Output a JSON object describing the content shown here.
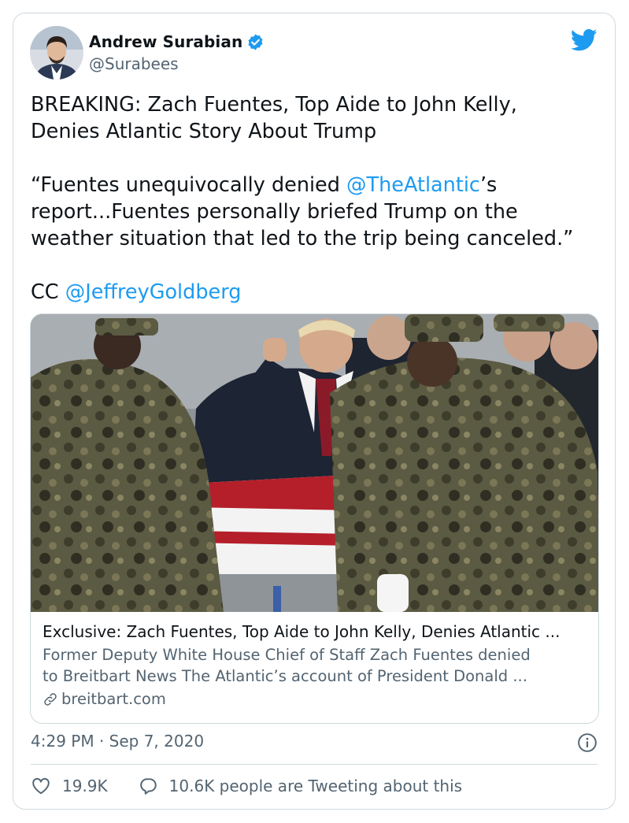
{
  "author": {
    "display_name": "Andrew Surabian",
    "handle": "@Surabees",
    "verified": true
  },
  "tweet": {
    "line1": "BREAKING: Zach Fuentes, Top Aide to John Kelly,",
    "line2": "Denies Atlantic Story About Trump",
    "quote_prefix": "“Fuentes unequivocally denied ",
    "mention_atlantic": "@TheAtlantic",
    "quote_suffix": "’s\nreport...Fuentes personally briefed Trump on the\nweather situation that led to the trip being canceled.”",
    "cc_prefix": "CC ",
    "mention_goldberg": "@JeffreyGoldberg"
  },
  "link_card": {
    "title": "Exclusive: Zach Fuentes, Top Aide to John Kelly, Denies Atlantic ...",
    "description_line1": "Former Deputy White House Chief of Staff Zach Fuentes denied",
    "description_line2": "to Breitbart News The Atlantic’s account of President Donald ...",
    "domain": "breitbart.com"
  },
  "meta": {
    "timestamp": "4:29 PM · Sep 7, 2020"
  },
  "actions": {
    "likes": "19.9K",
    "replies_text": "10.6K people are Tweeting about this"
  },
  "colors": {
    "link": "#1d9bf0",
    "secondary": "#536471",
    "border": "#cfd9de"
  }
}
